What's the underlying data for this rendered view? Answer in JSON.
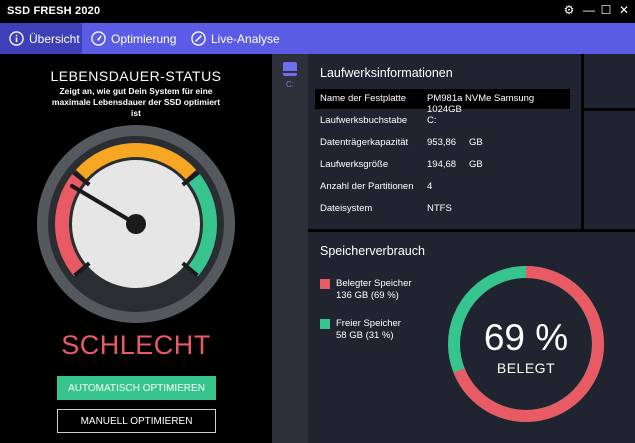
{
  "app": {
    "title": "SSD FRESH 2020"
  },
  "window_controls": {
    "settings": "⚙",
    "minimize": "—",
    "maximize": "☐",
    "close": "✕"
  },
  "nav": {
    "tabs": [
      {
        "label": "Übersicht",
        "icon": "info-icon",
        "active": true
      },
      {
        "label": "Optimierung",
        "icon": "speedometer-icon",
        "active": false
      },
      {
        "label": "Live-Analyse",
        "icon": "pen-icon",
        "active": false
      }
    ]
  },
  "lifespan": {
    "title": "LEBENSDAUER-STATUS",
    "subtitle": "Zeigt an, wie gut Dein System für eine maximale Lebensdauer der SSD optimiert ist",
    "verdict": "SCHLECHT",
    "auto_button": "AUTOMATISCH OPTIMIEREN",
    "manual_button": "MANUELL OPTIMIEREN",
    "colors": {
      "bad": "#e85a64",
      "warn": "#f6a623",
      "good": "#36c58c"
    }
  },
  "drives": [
    {
      "letter": "C:",
      "icon": "drive-icon"
    }
  ],
  "drive_info": {
    "title": "Laufwerksinformationen",
    "rows": [
      {
        "key": "Name der Festplatte",
        "value": "PM981a NVMe Samsung 1024GB",
        "unit": ""
      },
      {
        "key": "Laufwerksbuchstabe",
        "value": "C:",
        "unit": ""
      },
      {
        "key": "Datenträgerkapazität",
        "value": "953,86",
        "unit": "GB"
      },
      {
        "key": "Laufwerksgröße",
        "value": "194,68",
        "unit": "GB"
      },
      {
        "key": "Anzahl der Partitionen",
        "value": "4",
        "unit": ""
      },
      {
        "key": "Dateisystem",
        "value": "NTFS",
        "unit": ""
      }
    ]
  },
  "usage": {
    "title": "Speicherverbrauch",
    "used_label": "Belegter Speicher",
    "used_value": "136 GB (69 %)",
    "free_label": "Freier Speicher",
    "free_value": "58 GB (31 %)",
    "percent_text": "69 %",
    "center_label": "BELEGT",
    "used_fraction": 0.69,
    "colors": {
      "used": "#e85a64",
      "free": "#36c58c"
    }
  }
}
